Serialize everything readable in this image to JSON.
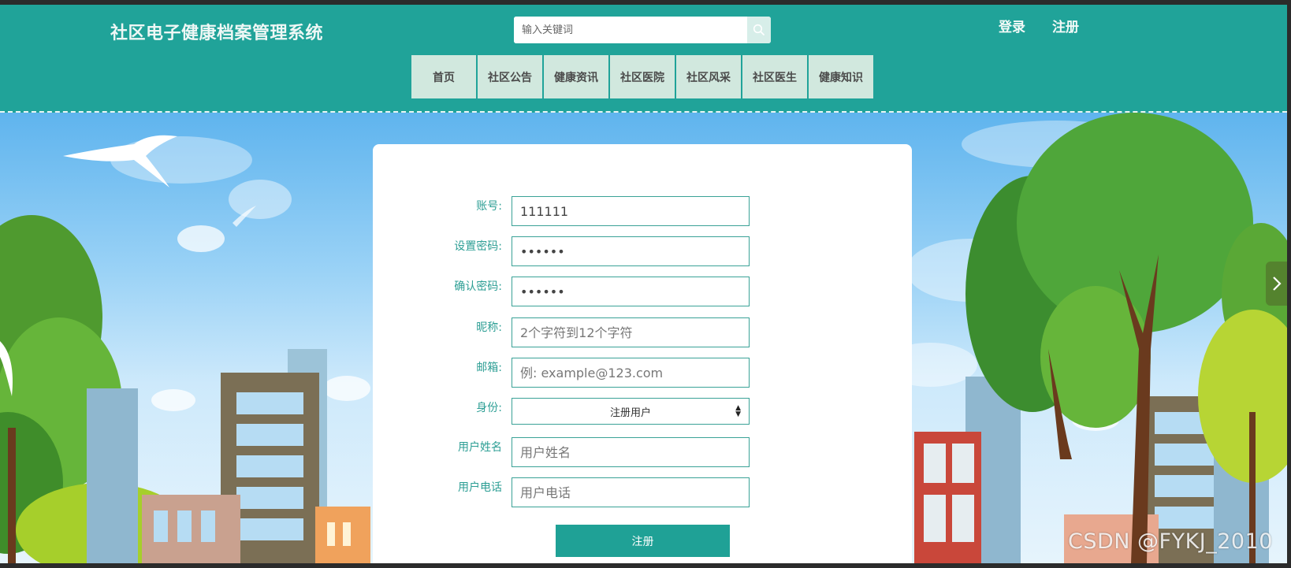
{
  "header": {
    "title": "社区电子健康档案管理系统",
    "search_placeholder": "输入关键词",
    "login_label": "登录",
    "register_label": "注册"
  },
  "nav": {
    "items": [
      "首页",
      "社区公告",
      "健康资讯",
      "社区医院",
      "社区风采",
      "社区医生",
      "健康知识"
    ]
  },
  "form": {
    "account": {
      "label": "账号:",
      "value": "111111"
    },
    "password": {
      "label": "设置密码:",
      "value": "111111"
    },
    "confirm_password": {
      "label": "确认密码:",
      "value": "111111"
    },
    "nickname": {
      "label": "昵称:",
      "placeholder": "2个字符到12个字符"
    },
    "email": {
      "label": "邮箱:",
      "placeholder": "例: example@123.com"
    },
    "role": {
      "label": "身份:",
      "selected": "注册用户"
    },
    "real_name": {
      "label": "用户姓名",
      "placeholder": "用户姓名"
    },
    "phone": {
      "label": "用户电话",
      "placeholder": "用户电话"
    },
    "submit_label": "注册"
  },
  "watermark": "CSDN @FYKJ_2010",
  "colors": {
    "header_bg": "#20a399",
    "nav_item_bg": "#d1e8de",
    "accent": "#1fa196",
    "label_text": "#2c9e94"
  },
  "icons": {
    "search": "search-icon",
    "carousel_next": "chevron-right-icon"
  }
}
